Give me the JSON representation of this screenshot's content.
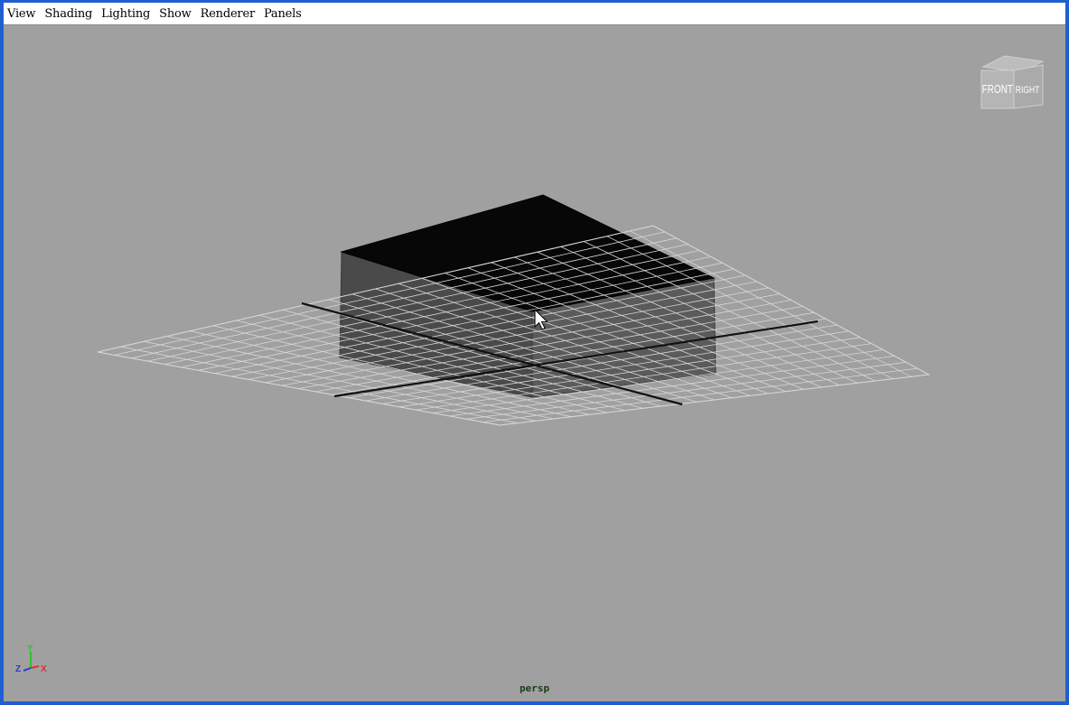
{
  "menubar": {
    "items": [
      "View",
      "Shading",
      "Lighting",
      "Show",
      "Renderer",
      "Panels"
    ]
  },
  "viewcube": {
    "front_label": "FRONT",
    "right_label": "RIGHT"
  },
  "axis_gizmo": {
    "y_label": "Y",
    "z_label": "Z",
    "x_label": "X",
    "colors": {
      "x": "#e03030",
      "y": "#30c030",
      "z": "#2a3ad0"
    }
  },
  "viewport": {
    "camera": "persp",
    "background": "#a0a0a0"
  },
  "cursor": "arrow-pointer-icon"
}
